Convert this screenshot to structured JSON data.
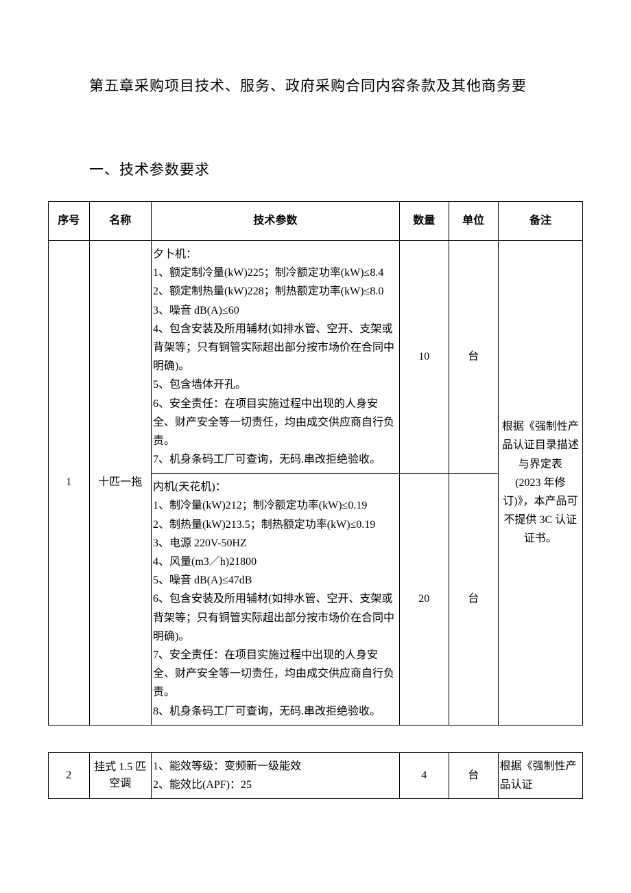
{
  "chapter_title": "第五章采购项目技术、服务、政府采购合同内容条款及其他商务要",
  "section_title": "一、技术参数要求",
  "headers": {
    "seq": "序号",
    "name": "名称",
    "spec": "技术参数",
    "qty": "数量",
    "unit": "单位",
    "remark": "备注"
  },
  "rows": [
    {
      "seq": "1",
      "name": "十匹一拖",
      "spec_a": "夕卜机：\n1、额定制冷量(kW)225；制冷额定功率(kW)≤8.4\n2、额定制热量(kW)228；制热额定功率(kW)≤8.0\n3、噪音 dB(A)≤60\n4、包含安装及所用辅材(如排水管、空开、支架或背架等；只有铜管实际超出部分按市场价在合同中明确)。\n5、包含墙体开孔。\n6、安全责任：在项目实施过程中出现的人身安全、财产安全等一切责任，均由成交供应商自行负责。\n7、机身条码工厂可查询，无码.串改拒绝验收。",
      "qty_a": "10",
      "unit_a": "台",
      "spec_b": "内机(天花机)：\n1、制冷量(kW)212；制冷额定功率(kW)≤0.19\n2、制热量(kW)213.5；制热额定功率(kW)≤0.19\n3、电源 220V-50HZ\n4、风量(m3／h)21800\n5、噪音 dB(A)≤47dB\n6、包含安装及所用辅材(如排水管、空开、支架或背架等；只有铜管实际超出部分按市场价在合同中明确)。\n7、安全责任：在项目实施过程中出现的人身安全、财产安全等一切责任，均由成交供应商自行负责。\n8、机身条码工厂可查询，无码.串改拒绝验收。",
      "qty_b": "20",
      "unit_b": "台",
      "remark": "根据《强制性产品认证目录描述与界定表\n(2023 年修订)》，本产品可不提供 3C 认证证书。"
    },
    {
      "seq": "2",
      "name": "挂式 1.5 匹空调",
      "spec": "1、能效等级：变频新一级能效\n2、能效比(APF)：25",
      "qty": "4",
      "unit": "台",
      "remark": "根据《强制性产品认证"
    }
  ]
}
